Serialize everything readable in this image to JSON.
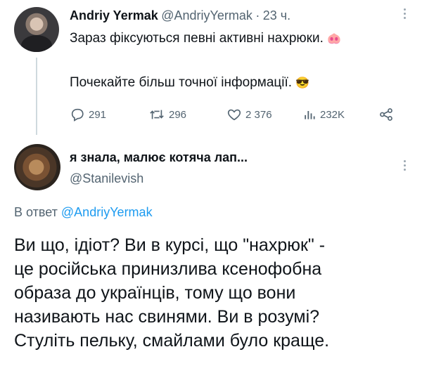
{
  "tweet1": {
    "author_name": "Andriy Yermak",
    "author_handle": "@AndriyYermak",
    "separator": "·",
    "time": "23 ч.",
    "line1": "Зараз фіксуються певні активні нахрюки.",
    "line1_emoji": "🐽",
    "line2": "Почекайте більш точної інформації.",
    "line2_emoji": "😎",
    "stats": {
      "replies": "291",
      "retweets": "296",
      "likes": "2 376",
      "views": "232K"
    }
  },
  "tweet2": {
    "author_name": "я знала, малює котяча лап...",
    "author_handle": "@Stanilevish",
    "reply_prefix": "В ответ",
    "reply_to": "@AndriyYermak",
    "lines": [
      "Ви що, ідіот? Ви в курсі, що \"нахрюк\" -",
      "це російська принизлива ксенофобна",
      "образа до українців, тому що вони",
      "називають нас свинями. Ви в розумі?",
      "Стуліть пельку, смайлами було краще."
    ]
  },
  "colors": {
    "muted": "#536471",
    "link": "#1d9bf0",
    "text": "#0f1419",
    "thread_line": "#cfd9de"
  },
  "icons": [
    "reply-icon",
    "retweet-icon",
    "like-icon",
    "views-icon",
    "share-icon",
    "more-icon"
  ]
}
